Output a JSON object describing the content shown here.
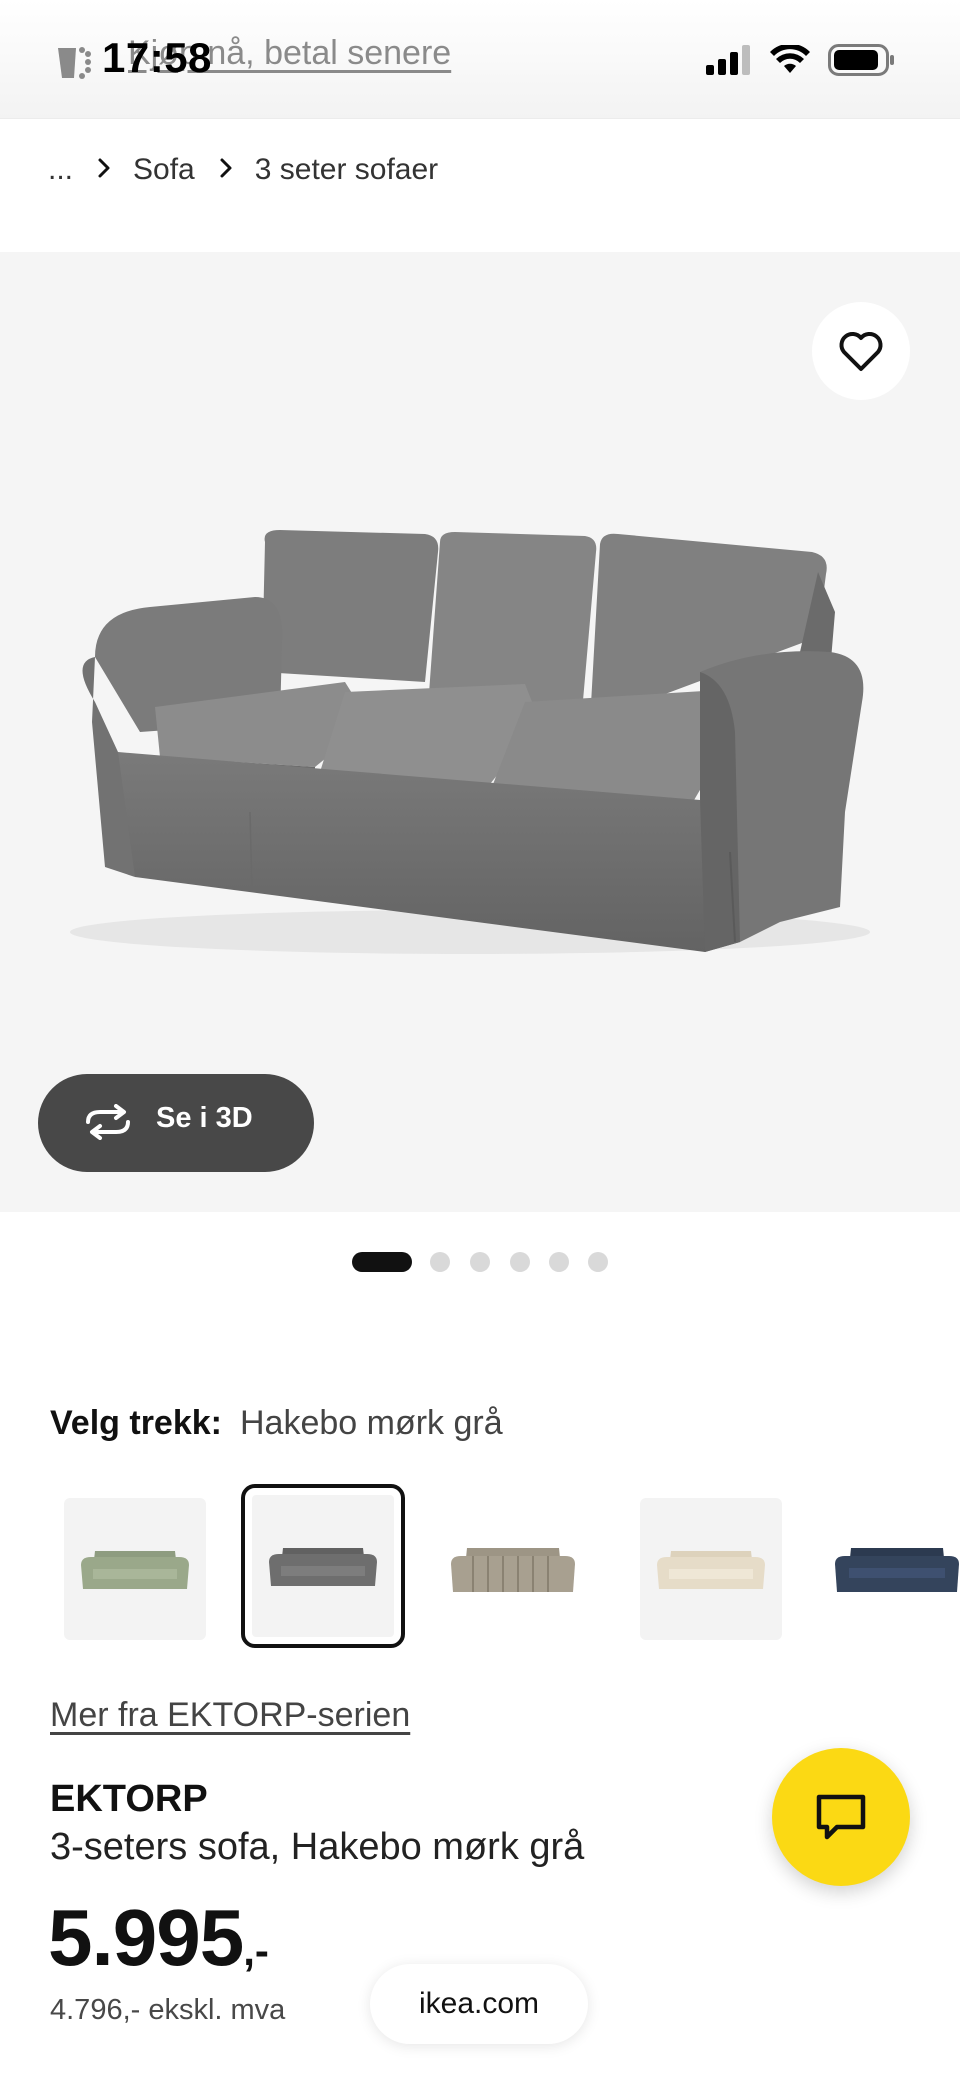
{
  "status_bar": {
    "time": "17:58",
    "promo_text": "Kjøp nå, betal senere"
  },
  "breadcrumb": {
    "ellipsis": "...",
    "items": [
      "Sofa",
      "3 seter sofaer"
    ]
  },
  "hero": {
    "button_3d_label": "Se i 3D",
    "icons": [
      "heart-icon",
      "rotate-3d-icon"
    ],
    "image_count": 6,
    "active_image": 1
  },
  "fabric": {
    "label": "Velg trekk:",
    "selected_value": "Hakebo mørk grå",
    "swatches": [
      {
        "color": "#9aa88a"
      },
      {
        "color": "#6e6e6e"
      },
      {
        "color": "#a8a090"
      },
      {
        "color": "#e6dcc8"
      },
      {
        "color": "#34445c"
      }
    ],
    "selected_index": 1
  },
  "product": {
    "series_link": "Mer fra EKTORP-serien",
    "name": "EKTORP",
    "description": "3-seters sofa, Hakebo mørk grå",
    "price": "5.995",
    "price_suffix": ",-",
    "price_excl_vat": "4.796,- ekskl. mva"
  },
  "footer": {
    "site": "ikea.com"
  },
  "colors": {
    "chat_button": "#fbd914",
    "sofa": "#737373",
    "button_3d_bg": "#484848"
  }
}
